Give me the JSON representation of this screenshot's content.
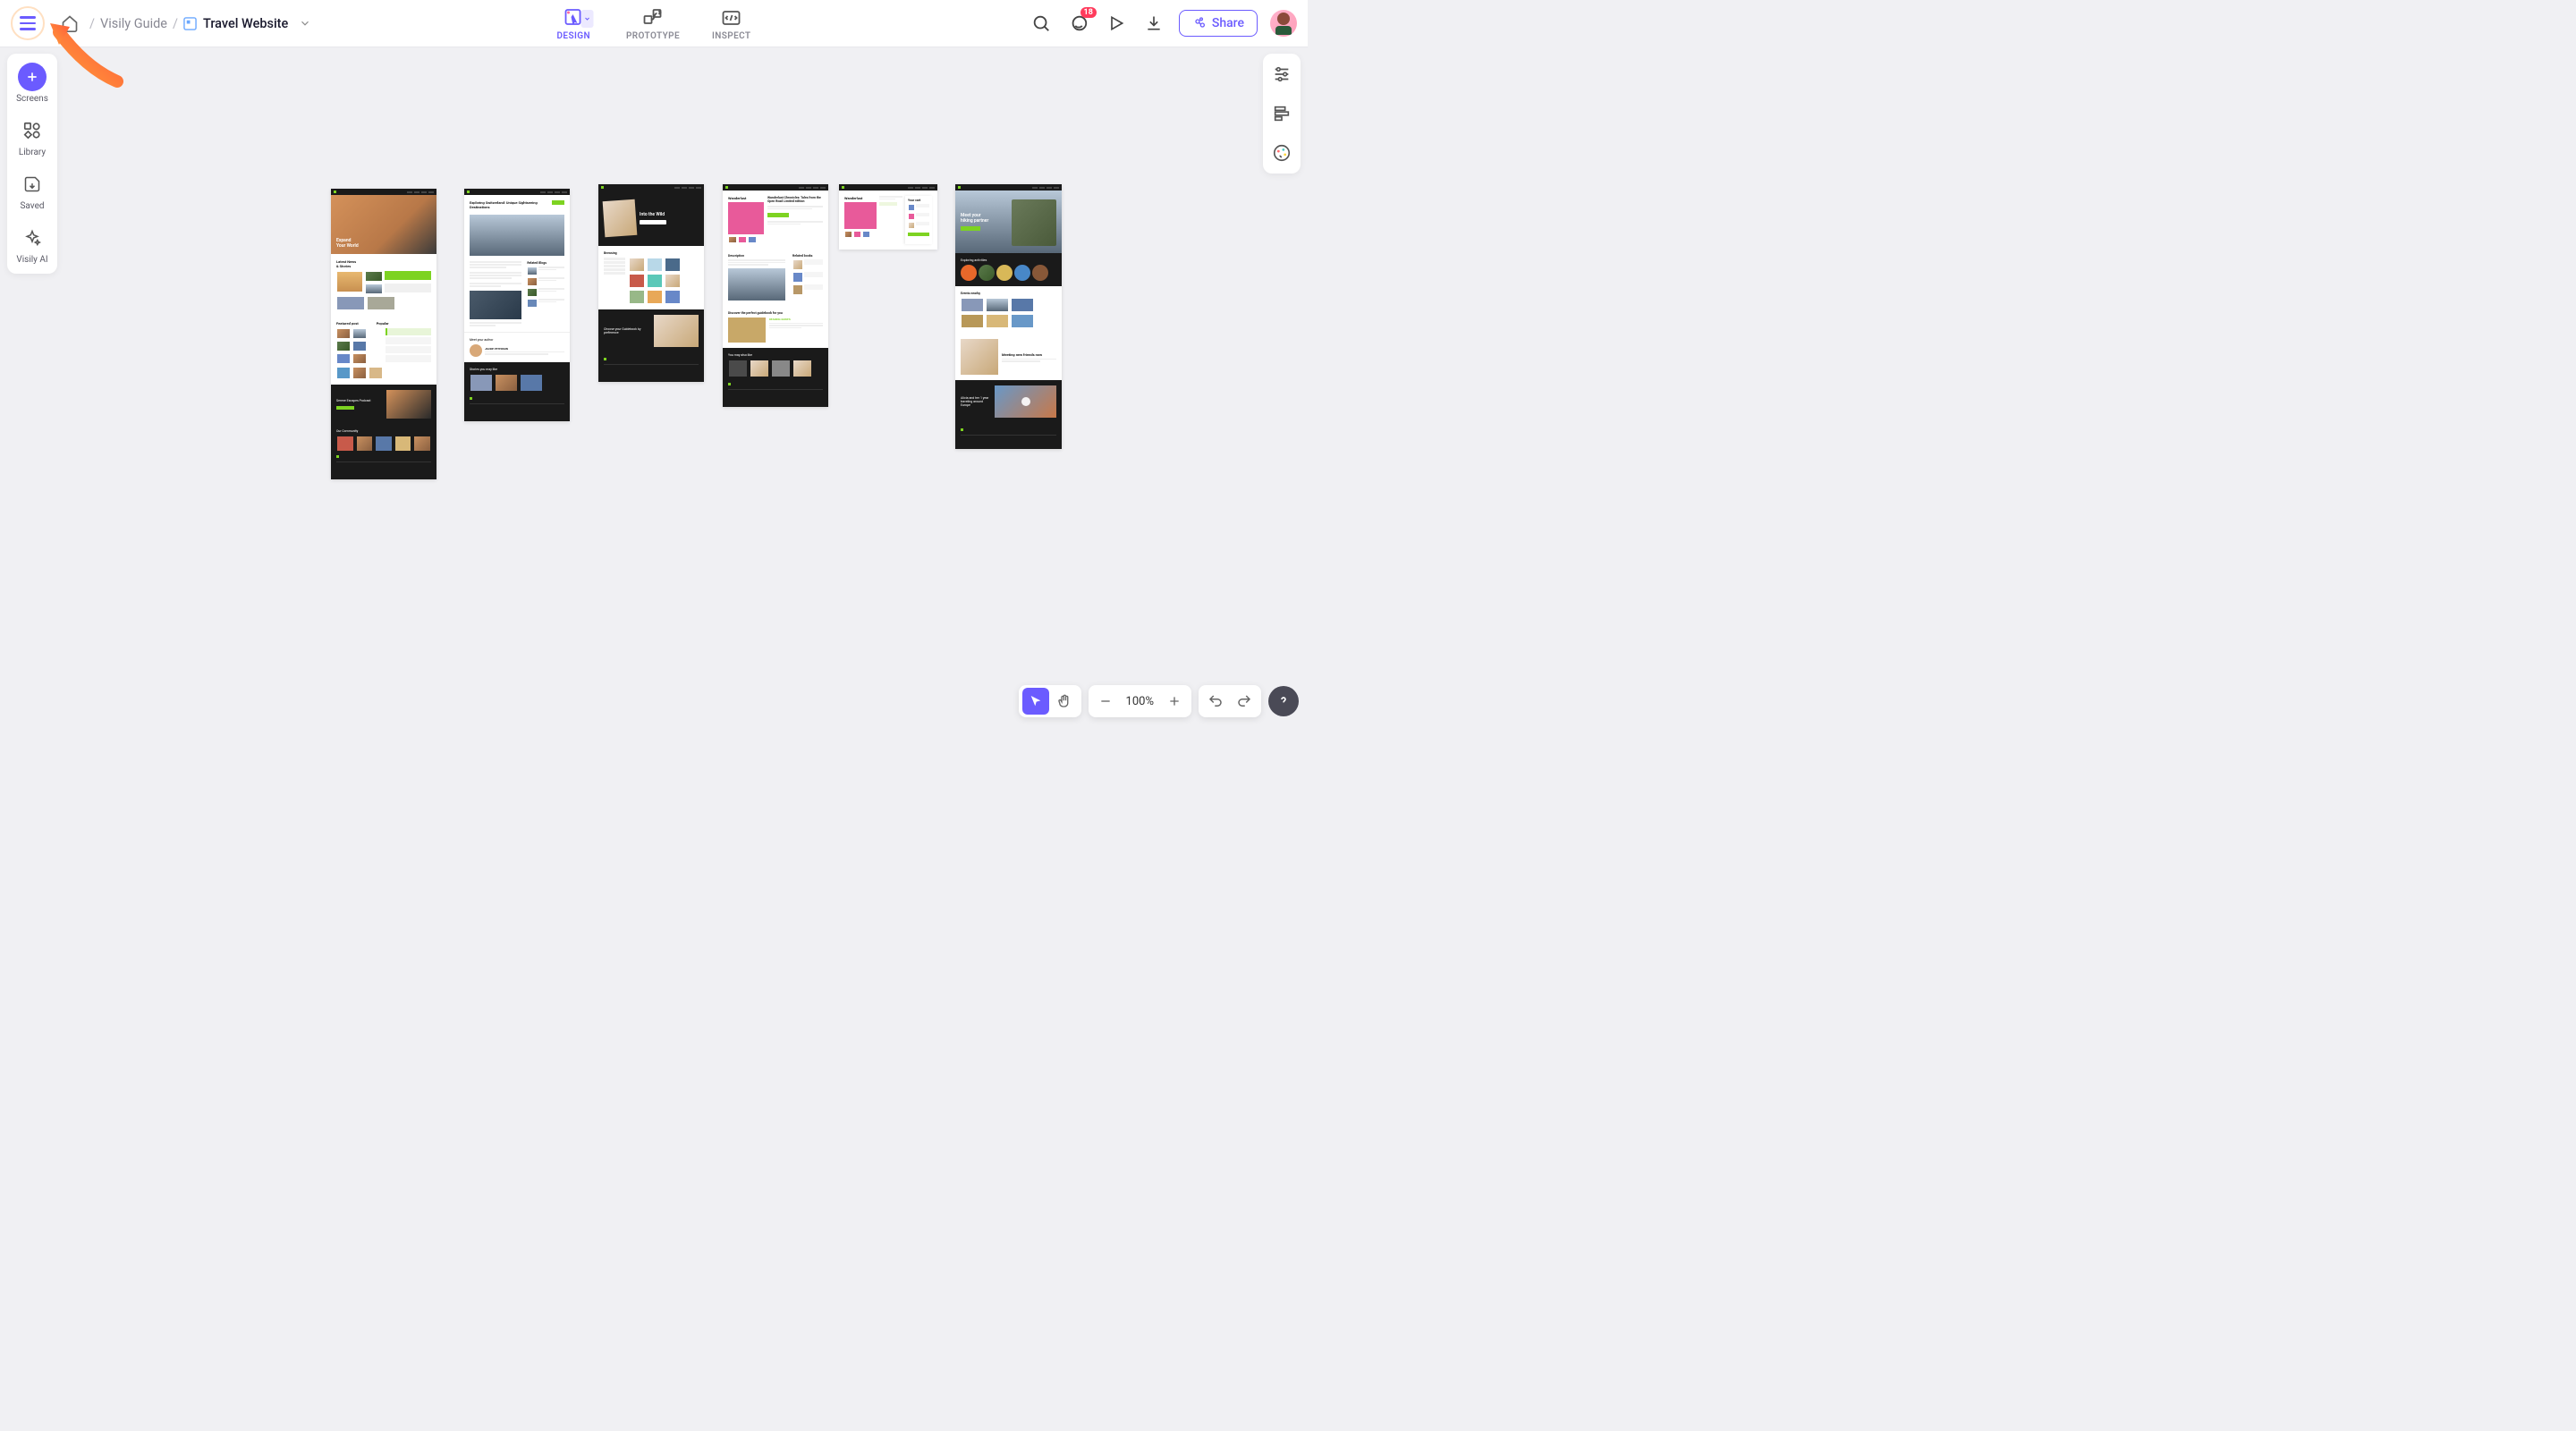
{
  "breadcrumb": {
    "workspace": "Visily Guide",
    "project": "Travel Website"
  },
  "modes": {
    "design": "DESIGN",
    "prototype": "PROTOTYPE",
    "inspect": "INSPECT"
  },
  "topbarRight": {
    "notificationCount": "18",
    "shareLabel": "Share"
  },
  "leftSidebar": {
    "screens": "Screens",
    "library": "Library",
    "saved": "Saved",
    "ai": "Visily AI"
  },
  "zoom": {
    "level": "100%"
  },
  "artboards": {
    "a1": {
      "heroTitle": "Expand\nYour World",
      "section1": "Latest News\n& Stories",
      "featured": "Featured post",
      "popular": "Popular",
      "podcast": "Serene Escapes Podcast",
      "community": "Our Community"
    },
    "a2": {
      "title": "Exploring Switzerland: Unique Sightseeing Destinations",
      "related": "Related Blogs",
      "author": "Meet your author",
      "stories": "Stories you may like"
    },
    "a3": {
      "hero": "Into the Wild",
      "browsing": "Browsing",
      "guidebook": "Choose your Guidebook by preference"
    },
    "a4": {
      "title": "Wanderlust",
      "subtitle": "Wanderlust Chronicles: Tales from the Open Road Limited edition",
      "desc": "Description",
      "related": "Related books",
      "discover": "Discover the perfect guidebook for you",
      "alsolike": "You may also like"
    },
    "a5": {
      "title": "Wanderlust",
      "cart": "Your cart"
    },
    "a6": {
      "hero": "Meet your\nhiking partner",
      "exploring": "Exploring activities",
      "events": "Events nearby",
      "meeting": "Meeting new friends now",
      "story": "Alicia and her 1 year traveling around Europe"
    }
  }
}
